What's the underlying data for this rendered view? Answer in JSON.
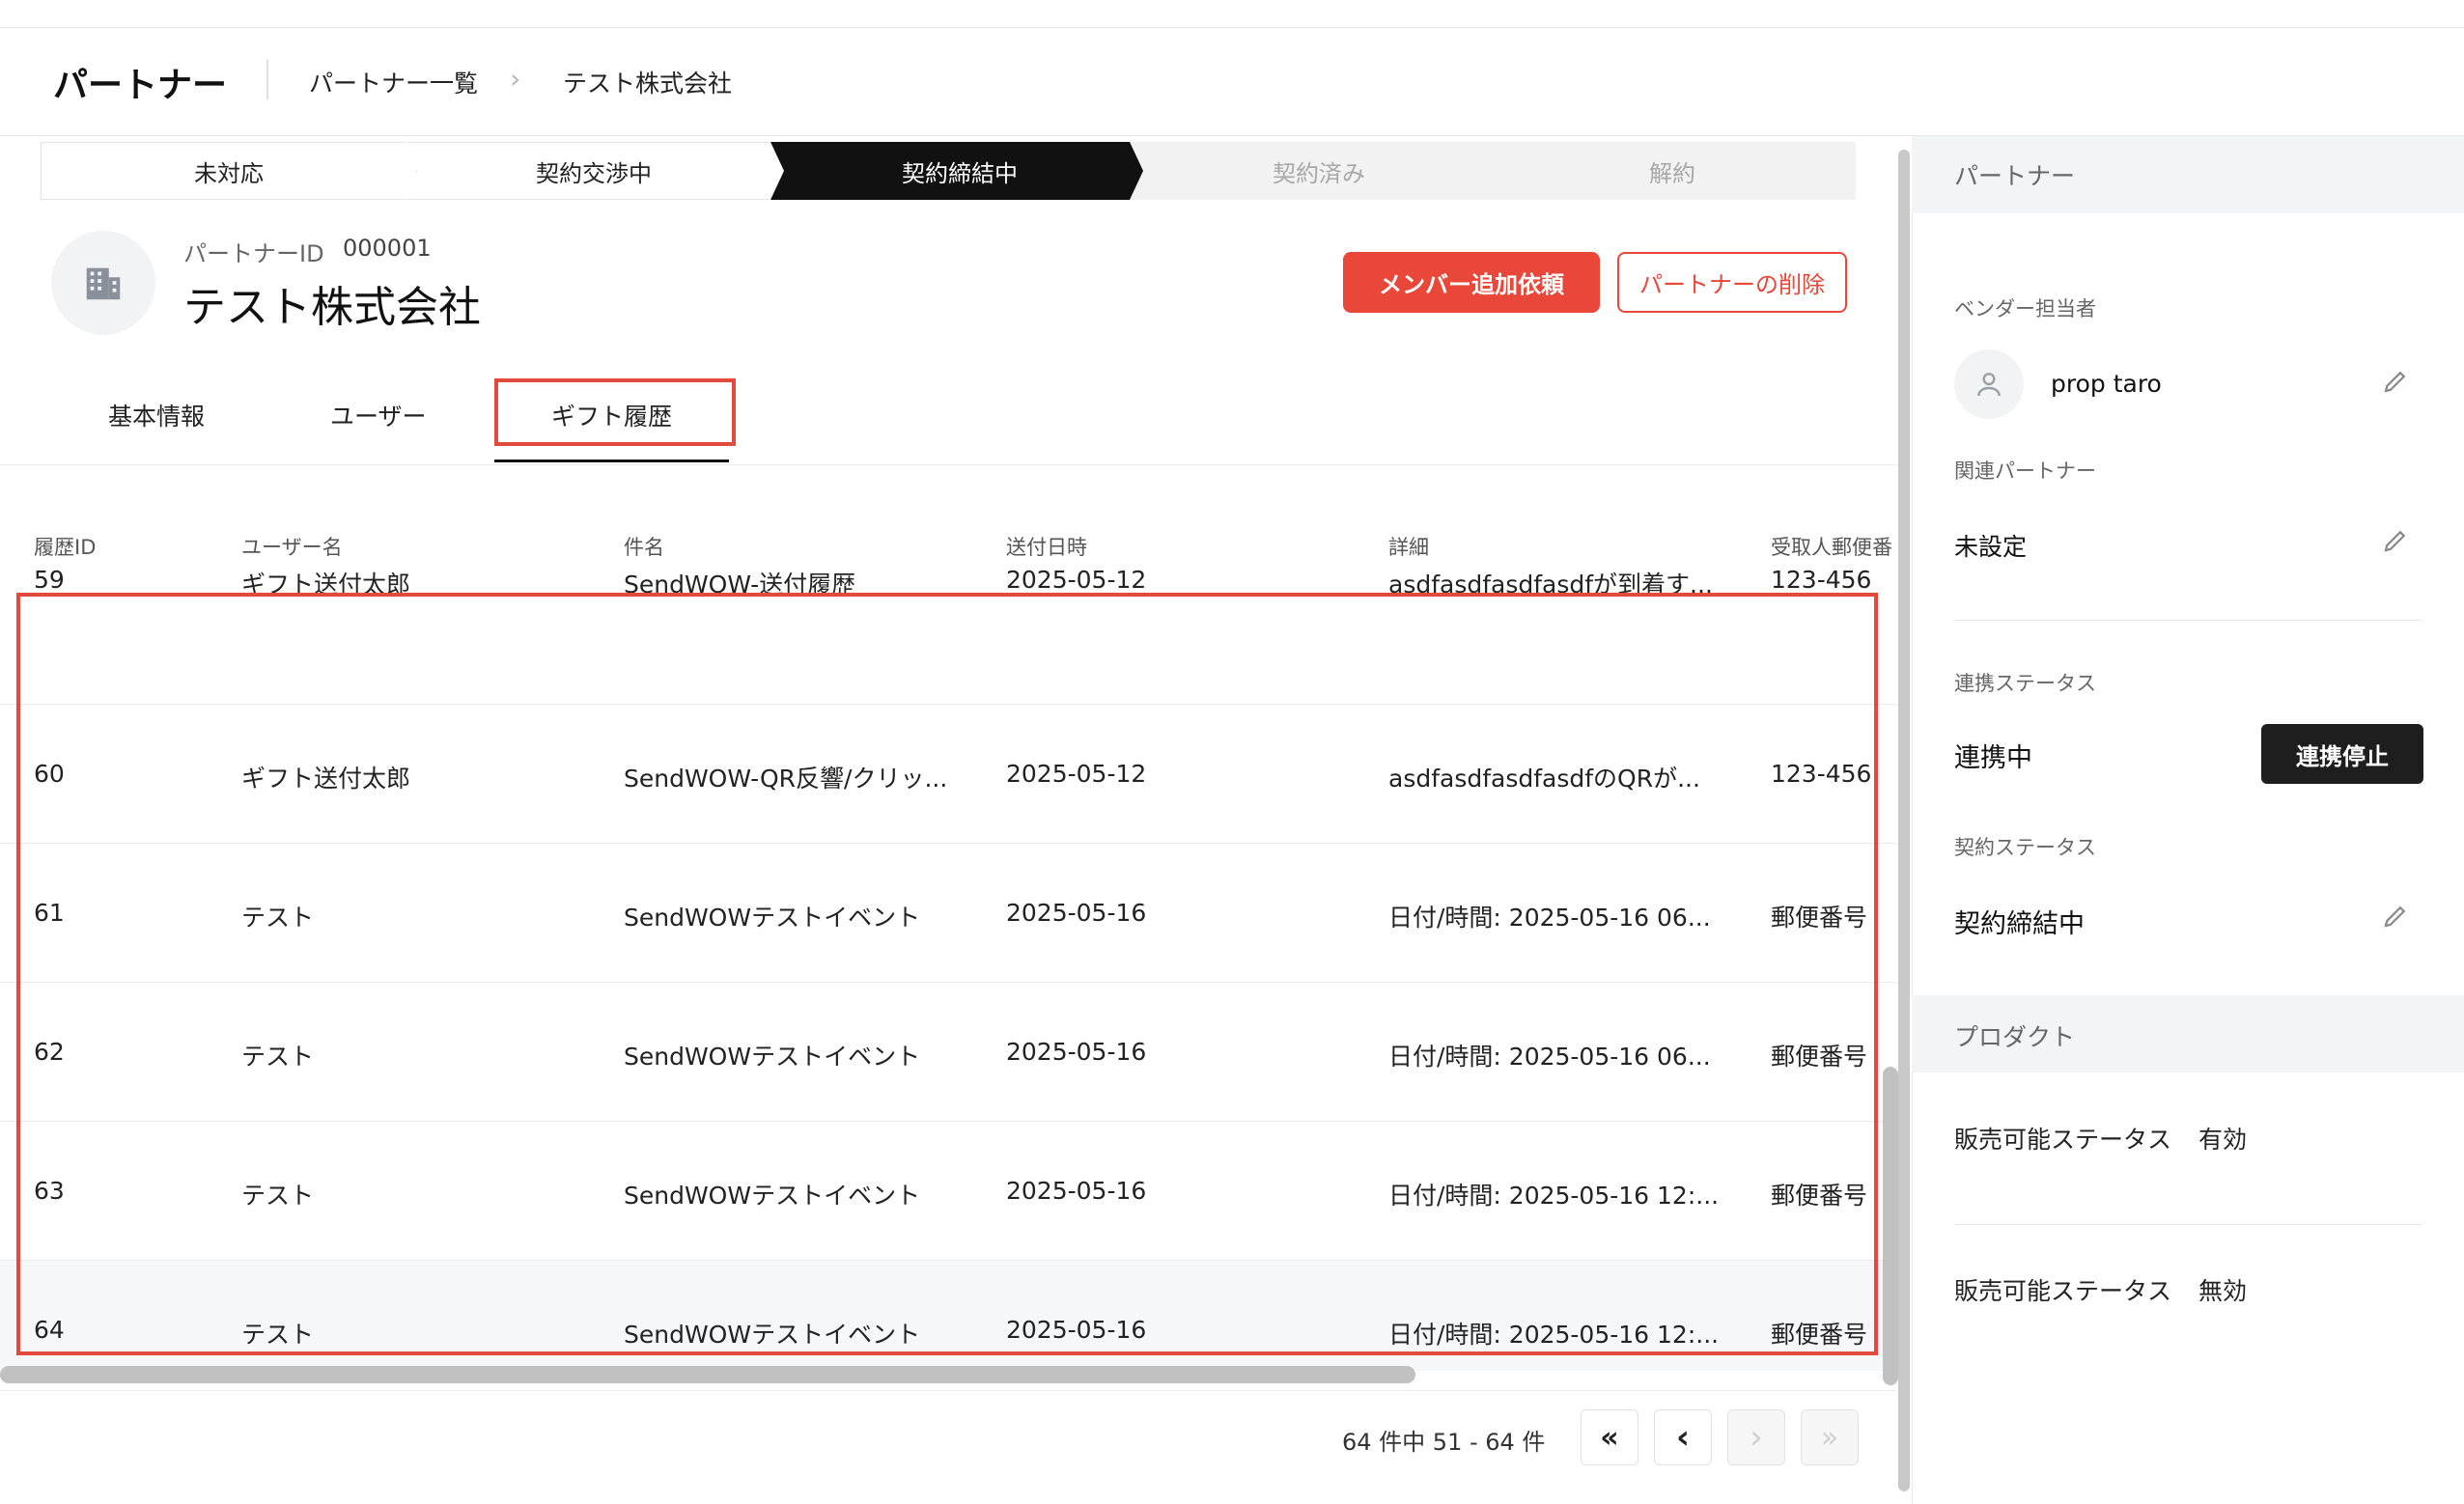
{
  "header": {
    "title": "パートナー",
    "breadcrumb": [
      "パートナー一覧",
      "テスト株式会社"
    ]
  },
  "steps": [
    "未対応",
    "契約交渉中",
    "契約締結中",
    "契約済み",
    "解約"
  ],
  "active_step": "契約締結中",
  "partner": {
    "id_label": "パートナーID",
    "id_value": "000001",
    "name": "テスト株式会社",
    "add_member_button": "メンバー追加依頼",
    "delete_button": "パートナーの削除"
  },
  "tabs": [
    "基本情報",
    "ユーザー",
    "ギフト履歴"
  ],
  "active_tab": "ギフト履歴",
  "table": {
    "columns": [
      "履歴ID",
      "ユーザー名",
      "件名",
      "送付日時",
      "詳細",
      "受取人郵便番"
    ],
    "rows": [
      {
        "id": "59",
        "user": "ギフト送付太郎",
        "subject": "SendWOW-送付履歴",
        "date": "2025-05-12",
        "detail": "asdfasdfasdfasdfが到着す...",
        "zip": "123-456"
      },
      {
        "id": "60",
        "user": "ギフト送付太郎",
        "subject": "SendWOW-QR反響/クリッ...",
        "date": "2025-05-12",
        "detail": "asdfasdfasdfasdfのQRが...",
        "zip": "123-456"
      },
      {
        "id": "61",
        "user": "テスト",
        "subject": "SendWOWテストイベント",
        "date": "2025-05-16",
        "detail": "日付/時間: 2025-05-16 06...",
        "zip": "郵便番号"
      },
      {
        "id": "62",
        "user": "テスト",
        "subject": "SendWOWテストイベント",
        "date": "2025-05-16",
        "detail": "日付/時間: 2025-05-16 06...",
        "zip": "郵便番号"
      },
      {
        "id": "63",
        "user": "テスト",
        "subject": "SendWOWテストイベント",
        "date": "2025-05-16",
        "detail": "日付/時間: 2025-05-16 12:...",
        "zip": "郵便番号"
      },
      {
        "id": "64",
        "user": "テスト",
        "subject": "SendWOWテストイベント",
        "date": "2025-05-16",
        "detail": "日付/時間: 2025-05-16 12:...",
        "zip": "郵便番号"
      }
    ]
  },
  "pagination": {
    "summary": "64 件中  51 - 64 件"
  },
  "sidebar": {
    "header": "パートナー",
    "vendor_label": "ベンダー担当者",
    "vendor_name": "prop taro",
    "related_label": "関連パートナー",
    "related_value": "未設定",
    "link_status_label": "連携ステータス",
    "link_status_value": "連携中",
    "stop_button": "連携停止",
    "contract_status_label": "契約ステータス",
    "contract_status_value": "契約締結中",
    "product_header": "プロダクト",
    "products": [
      {
        "label": "販売可能ステータス",
        "value": "有効"
      },
      {
        "label": "販売可能ステータス",
        "value": "無効"
      }
    ]
  },
  "colors": {
    "accent_red": "#e8473a",
    "active_step_bg": "#111111",
    "highlight_border": "#e34a3e"
  }
}
